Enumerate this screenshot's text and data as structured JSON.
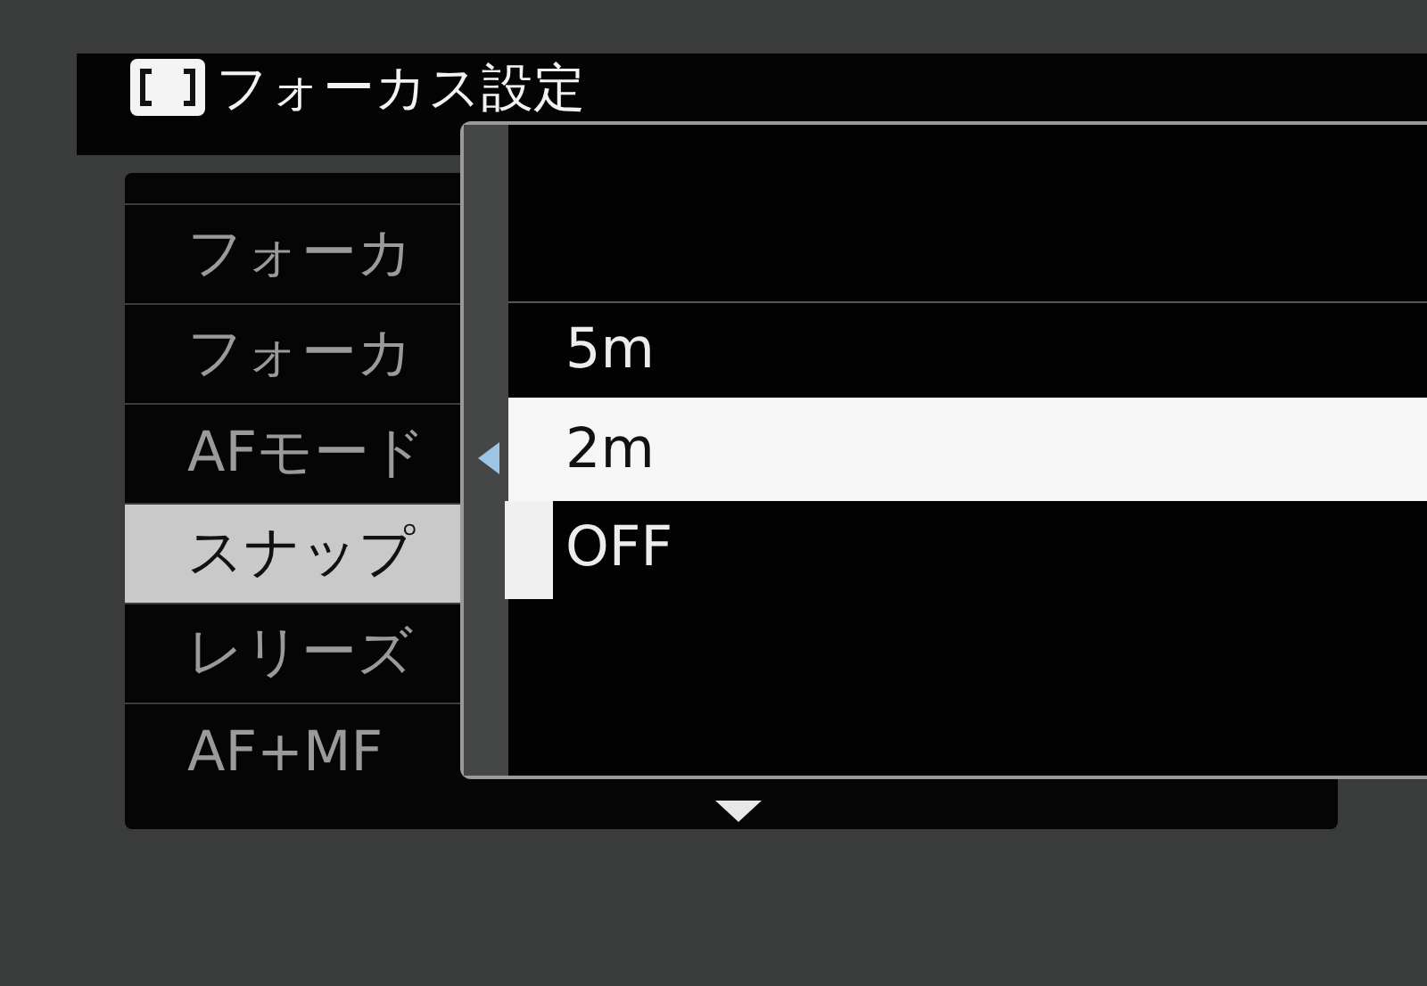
{
  "title": "フォーカス設定",
  "menu": [
    {
      "label": "フォーカ",
      "selected": false
    },
    {
      "label": "フォーカ",
      "selected": false
    },
    {
      "label": "AFモード",
      "selected": false
    },
    {
      "label": "スナップ",
      "selected": true
    },
    {
      "label": "レリーズ",
      "selected": false
    },
    {
      "label": "AF+MF",
      "selected": false
    }
  ],
  "options": [
    {
      "label": "5m",
      "selected": false
    },
    {
      "label": "2m",
      "selected": true
    },
    {
      "label": "OFF",
      "selected": false
    }
  ]
}
